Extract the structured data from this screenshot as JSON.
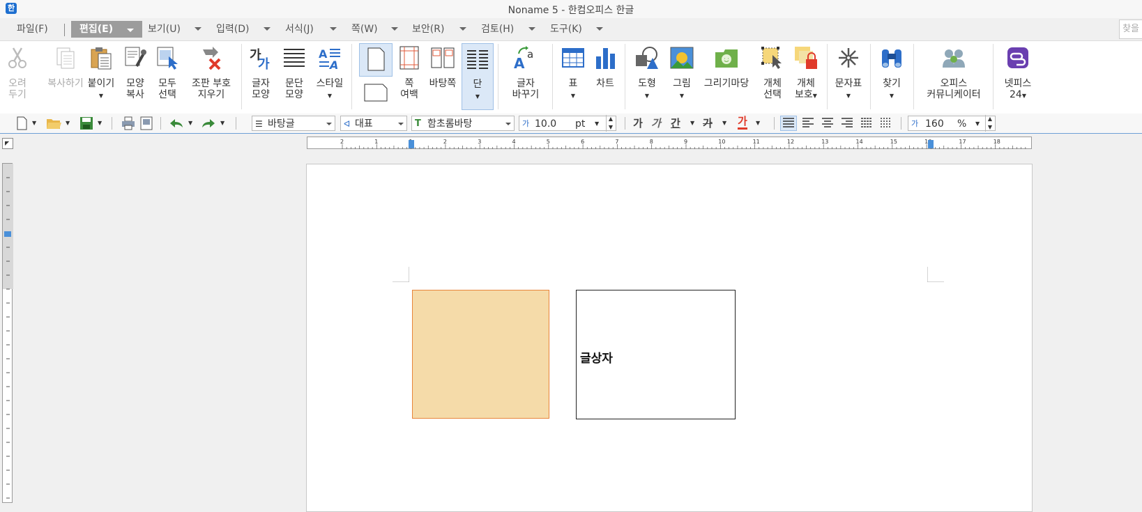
{
  "window": {
    "title": "Noname 5 - 한컴오피스 한글"
  },
  "menu": {
    "items": [
      {
        "label": "파일(F)"
      },
      {
        "label": "편집(E)"
      },
      {
        "label": "보기(U)"
      },
      {
        "label": "입력(D)"
      },
      {
        "label": "서식(J)"
      },
      {
        "label": "쪽(W)"
      },
      {
        "label": "보안(R)"
      },
      {
        "label": "검토(H)"
      },
      {
        "label": "도구(K)"
      }
    ],
    "active": "편집(E)",
    "search_placeholder": "찾을"
  },
  "ribbon": {
    "buttons": [
      {
        "label": "오려\n두기",
        "icon": "scissors-icon",
        "enabled": false
      },
      {
        "label": "복사하기",
        "icon": "copy-icon",
        "enabled": false
      },
      {
        "label": "붙이기",
        "icon": "paste-icon",
        "enabled": true
      },
      {
        "label": "모양\n복사",
        "icon": "format-painter-icon",
        "enabled": true
      },
      {
        "label": "모두\n선택",
        "icon": "select-all-icon",
        "enabled": true
      },
      {
        "label": "조판 부호\n지우기",
        "icon": "clear-format-icon",
        "enabled": true
      },
      {
        "label": "글자\n모양",
        "icon": "char-shape-icon",
        "enabled": true
      },
      {
        "label": "문단\n모양",
        "icon": "paragraph-shape-icon",
        "enabled": true
      },
      {
        "label": "스타일",
        "icon": "style-icon",
        "enabled": true
      },
      {
        "label": "쪽\n여백",
        "icon": "page-margin-icon",
        "enabled": true
      },
      {
        "label": "바탕쪽",
        "icon": "master-page-icon",
        "enabled": true
      },
      {
        "label": "단",
        "icon": "columns-icon",
        "enabled": true
      },
      {
        "label": "글자\n바꾸기",
        "icon": "char-replace-icon",
        "enabled": true
      },
      {
        "label": "표",
        "icon": "table-icon",
        "enabled": true
      },
      {
        "label": "차트",
        "icon": "chart-icon",
        "enabled": true
      },
      {
        "label": "도형",
        "icon": "shape-icon",
        "enabled": true
      },
      {
        "label": "그림",
        "icon": "picture-icon",
        "enabled": true
      },
      {
        "label": "그리기마당",
        "icon": "drawing-gallery-icon",
        "enabled": true
      },
      {
        "label": "개체\n선택",
        "icon": "object-select-icon",
        "enabled": true
      },
      {
        "label": "개체\n보호",
        "icon": "object-protect-icon",
        "enabled": true
      },
      {
        "label": "문자표",
        "icon": "symbol-icon",
        "enabled": true
      },
      {
        "label": "찾기",
        "icon": "binoculars-icon",
        "enabled": true
      },
      {
        "label": "오피스\n커뮤니케이터",
        "icon": "communicator-icon",
        "enabled": true
      },
      {
        "label": "넷피스\n24",
        "icon": "netffice-icon",
        "enabled": true
      }
    ]
  },
  "toolbar": {
    "style": "바탕글",
    "language": "대표",
    "font": "함초롬바탕",
    "font_size": "10.0",
    "font_unit": "pt",
    "line_spacing": "160",
    "line_spacing_unit": "%"
  },
  "format_labels": {
    "bold": "가",
    "italic": "가",
    "underline": "간",
    "strike": "가",
    "color": "가"
  },
  "document": {
    "text_box": "글상자"
  },
  "colors": {
    "shape_fill": "#f5dba9",
    "shape_border": "#e8843a",
    "menu_active": "#9c9c9c"
  },
  "ruler": {
    "h_ticks": [
      "2",
      "1",
      "1",
      "2",
      "3",
      "4",
      "5",
      "6",
      "7",
      "8",
      "9",
      "10",
      "11",
      "12",
      "13",
      "14",
      "15",
      "16",
      "17",
      "18"
    ]
  }
}
